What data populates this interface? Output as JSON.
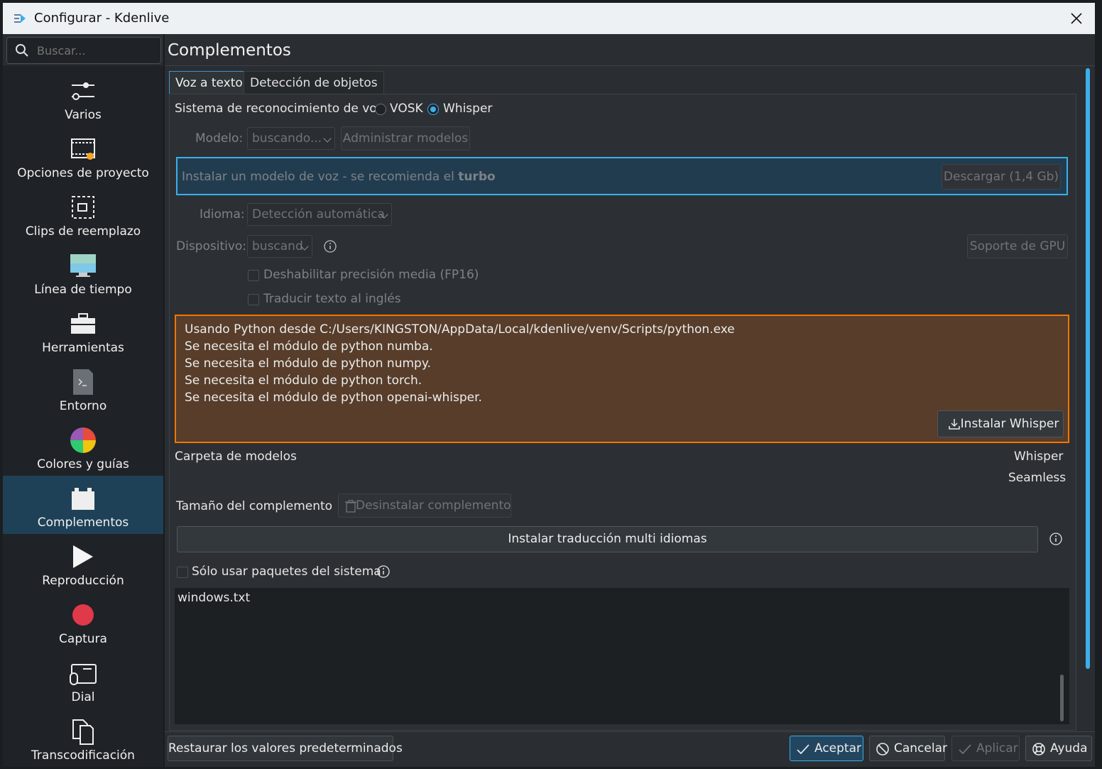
{
  "window": {
    "title": "Configurar - Kdenlive"
  },
  "search": {
    "placeholder": "Buscar..."
  },
  "sidebar": {
    "items": [
      {
        "label": "Varios",
        "icon": "sliders-icon"
      },
      {
        "label": "Opciones de proyecto",
        "icon": "film-settings-icon"
      },
      {
        "label": "Clips de reemplazo",
        "icon": "proxy-clip-icon"
      },
      {
        "label": "Línea de tiempo",
        "icon": "monitor-icon"
      },
      {
        "label": "Herramientas",
        "icon": "toolbox-icon"
      },
      {
        "label": "Entorno",
        "icon": "terminal-file-icon"
      },
      {
        "label": "Colores y guías",
        "icon": "color-wheel-icon"
      },
      {
        "label": "Complementos",
        "icon": "plugin-icon",
        "selected": true
      },
      {
        "label": "Reproducción",
        "icon": "play-icon"
      },
      {
        "label": "Captura",
        "icon": "record-icon"
      },
      {
        "label": "Dial",
        "icon": "jog-dial-icon"
      },
      {
        "label": "Transcodificación",
        "icon": "transcode-icon"
      }
    ]
  },
  "page": {
    "title": "Complementos"
  },
  "tabs": [
    {
      "label": "Voz a texto",
      "active": true
    },
    {
      "label": "Detección de objetos",
      "active": false
    }
  ],
  "speech": {
    "system_label": "Sistema de reconocimiento de voz",
    "option_vosk": "VOSK",
    "option_whisper": "Whisper",
    "selected": "Whisper",
    "model_label": "Modelo:",
    "model_value": "buscando...",
    "manage_models": "Administrar modelos",
    "info_text_prefix": "Instalar un modelo de voz - se recomienda el ",
    "info_text_bold": "turbo",
    "download_button": "Descargar (1,4 Gb)",
    "language_label": "Idioma:",
    "language_value": "Detección automática",
    "device_label": "Dispositivo:",
    "device_value": "buscand",
    "gpu_support": "Soporte de GPU",
    "disable_fp16": "Deshabilitar precisión media (FP16)",
    "translate_english": "Traducir texto al inglés",
    "warning_lines": [
      "Usando Python desde C:/Users/KINGSTON/AppData/Local/kdenlive/venv/Scripts/python.exe",
      "Se necesita el módulo de python numba.",
      "Se necesita el módulo de python numpy.",
      "Se necesita el módulo de python torch.",
      "Se necesita el módulo de python openai-whisper."
    ],
    "install_whisper": "Instalar Whisper",
    "models_folder_label": "Carpeta de modelos",
    "models_folder_whisper": "Whisper",
    "models_folder_seamless": "Seamless",
    "plugin_size_label": "Tamaño del complemento",
    "uninstall_plugin": "Desinstalar complemento",
    "install_translation": "Instalar traducción multi idiomas",
    "system_packages_only": "Sólo usar paquetes del sistema",
    "log_text": "windows.txt"
  },
  "footer": {
    "restore_defaults": "Restaurar los valores predeterminados",
    "accept": "Aceptar",
    "cancel": "Cancelar",
    "apply": "Aplicar",
    "help": "Ayuda"
  },
  "colors": {
    "accent": "#3daee9",
    "warning": "#f67400",
    "selection": "#1e4157"
  }
}
